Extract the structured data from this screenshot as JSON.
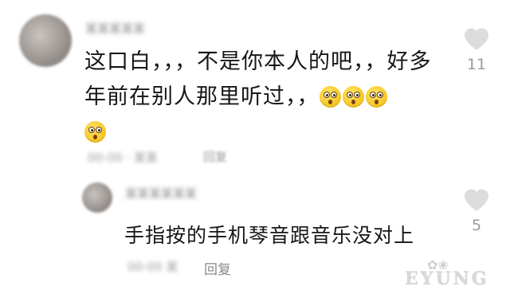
{
  "comment": {
    "text": "这口白，，，不是你本人的吧，，好多年前在别人那里听过，，",
    "emojis": [
      "astonished-emoji",
      "astonished-emoji",
      "astonished-emoji",
      "astonished-emoji"
    ],
    "likes": "11",
    "reply_label": "回复"
  },
  "reply": {
    "text": "手指按的手机琴音跟音乐没对上",
    "likes": "5",
    "reply_label": "回复"
  },
  "colors": {
    "text": "#161616",
    "secondary": "#9a9a9a",
    "like_icon": "#dcdcdc",
    "emoji": "#f6c21b"
  },
  "watermark": "EYUNG"
}
